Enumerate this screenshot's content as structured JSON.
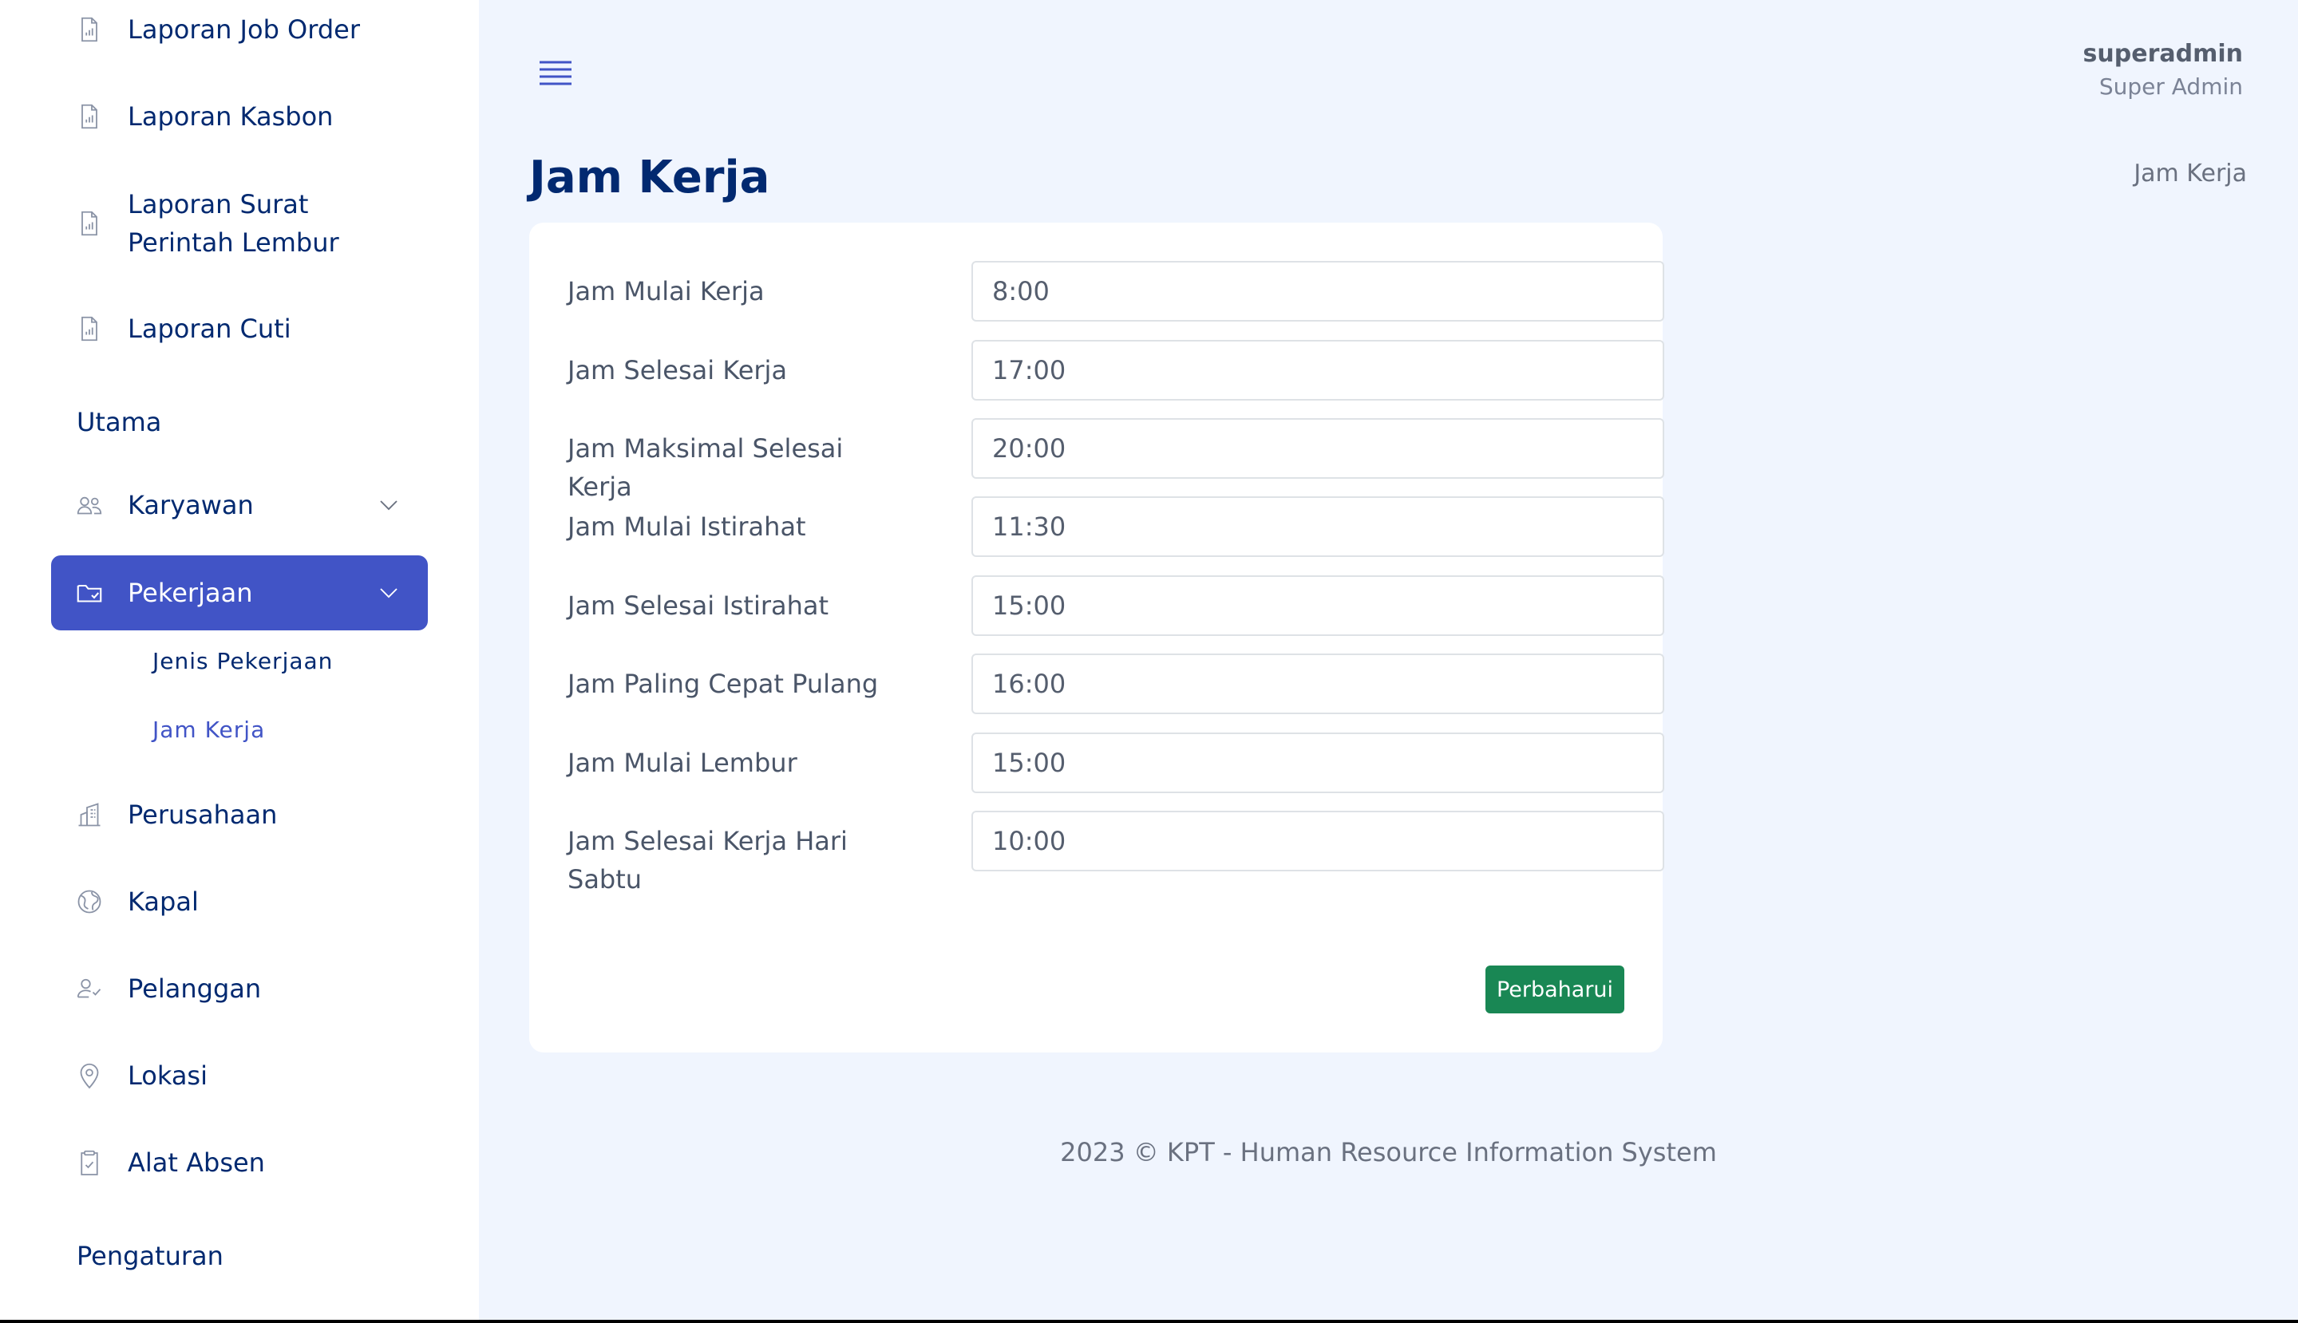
{
  "sidebar": {
    "items_top": [
      {
        "label": "Laporan Job Order",
        "icon": "report-icon"
      },
      {
        "label": "Laporan Kasbon",
        "icon": "report-icon"
      },
      {
        "label": "Laporan Surat Perintah Lembur",
        "icon": "report-icon"
      },
      {
        "label": "Laporan Cuti",
        "icon": "report-icon"
      }
    ],
    "heading_main": "Utama",
    "karyawan": {
      "label": "Karyawan",
      "icon": "people-icon"
    },
    "pekerjaan": {
      "label": "Pekerjaan",
      "icon": "folder-icon"
    },
    "pekerjaan_sub": [
      {
        "label": "Jenis Pekerjaan"
      },
      {
        "label": "Jam Kerja"
      }
    ],
    "items_bottom": [
      {
        "label": "Perusahaan",
        "icon": "building-icon"
      },
      {
        "label": "Kapal",
        "icon": "globe-icon"
      },
      {
        "label": "Pelanggan",
        "icon": "person-check-icon"
      },
      {
        "label": "Lokasi",
        "icon": "geo-pin-icon"
      },
      {
        "label": "Alat Absen",
        "icon": "clipboard-check-icon"
      }
    ],
    "heading_settings": "Pengaturan",
    "active_color": "#4154c6"
  },
  "header": {
    "user_name": "superadmin",
    "user_role": "Super Admin"
  },
  "page": {
    "title": "Jam Kerja",
    "breadcrumb": "Jam Kerja"
  },
  "form": {
    "fields": [
      {
        "label": "Jam Mulai Kerja",
        "value": "8:00"
      },
      {
        "label": "Jam Selesai Kerja",
        "value": "17:00"
      },
      {
        "label": "Jam Maksimal Selesai Kerja",
        "value": "20:00"
      },
      {
        "label": "Jam Mulai Istirahat",
        "value": "11:30"
      },
      {
        "label": "Jam Selesai Istirahat",
        "value": "15:00"
      },
      {
        "label": "Jam Paling Cepat Pulang",
        "value": "16:00"
      },
      {
        "label": "Jam Mulai Lembur",
        "value": "15:00"
      },
      {
        "label": "Jam Selesai Kerja Hari Sabtu",
        "value": "10:00"
      }
    ],
    "submit_label": "Perbaharui",
    "submit_color": "#198754"
  },
  "footer": {
    "text": "2023 © KPT - Human Resource Information System"
  }
}
